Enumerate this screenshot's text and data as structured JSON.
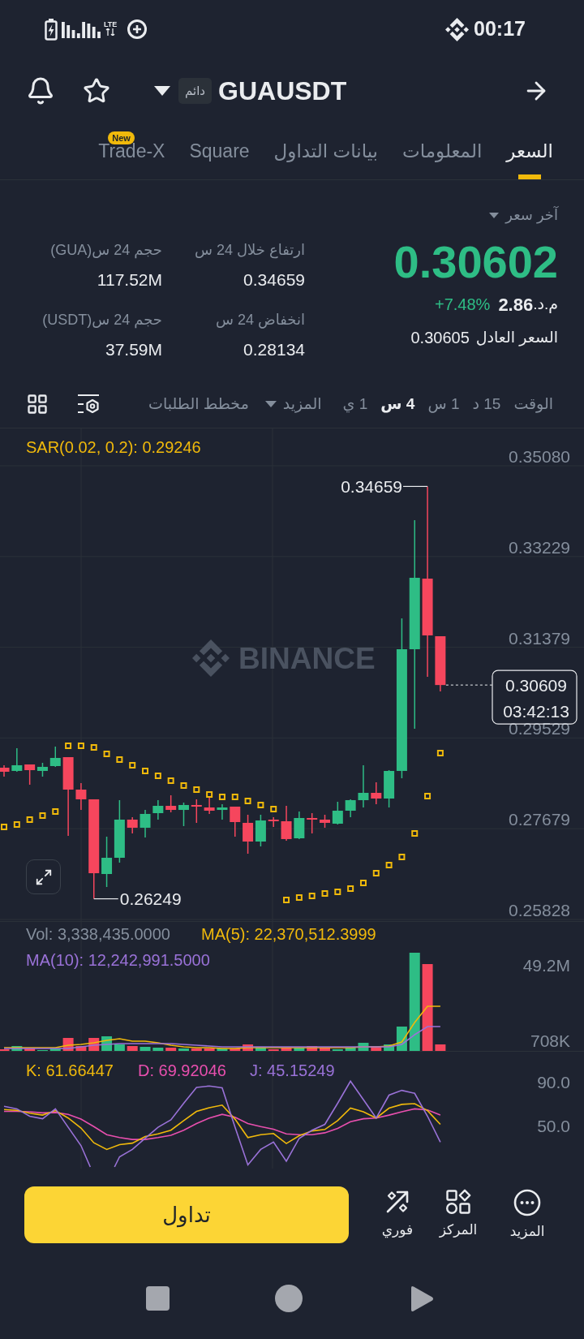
{
  "status_bar": {
    "network_type": "LTE",
    "time": "00:17"
  },
  "header": {
    "badge": "دائم",
    "symbol": "GUAUSDT"
  },
  "tabs": [
    {
      "label": "السعر",
      "selected": true
    },
    {
      "label": "المعلومات",
      "selected": false
    },
    {
      "label": "بيانات التداول",
      "selected": false
    },
    {
      "label": "Square",
      "selected": false
    },
    {
      "label": "Trade-X",
      "selected": false,
      "badge": "New"
    }
  ],
  "price_panel": {
    "price_type": "آخر سعر",
    "last_price": "0.30602",
    "change_percent": "+7.48%",
    "change_amount": "2.86",
    "currency": "م.د.",
    "fair_price_label": "السعر العادل",
    "fair_price": "0.30605"
  },
  "stats": [
    {
      "label": "ارتفاع خلال 24 س",
      "value": "0.34659"
    },
    {
      "label": "حجم 24 س(GUA)",
      "value": "117.52M"
    },
    {
      "label": "انخفاض 24 س",
      "value": "0.28134"
    },
    {
      "label": "حجم 24 س(USDT)",
      "value": "37.59M"
    }
  ],
  "chart_toolbar": {
    "label": "الوقت",
    "intervals": [
      {
        "label": "15 د",
        "selected": false
      },
      {
        "label": "1 س",
        "selected": false
      },
      {
        "label": "4 س",
        "selected": true
      },
      {
        "label": "1 ي",
        "selected": false
      }
    ],
    "more": "المزيد",
    "depth": "مخطط الطلبات"
  },
  "price_chart": {
    "indicator": "SAR(0.02, 0.2): 0.29246",
    "watermark": "BINANCE",
    "high_label": "0.34659",
    "low_label": "0.26249",
    "current_price": "0.30609",
    "countdown": "03:42:13",
    "chart_data": {
      "type": "candlestick",
      "grid": true,
      "ohlc": [
        [
          0.28923,
          0.28973,
          0.28741,
          0.2884
        ],
        [
          0.28857,
          0.2932,
          0.2884,
          0.28973
        ],
        [
          0.28989,
          0.28989,
          0.28576,
          0.28873
        ],
        [
          0.28857,
          0.29022,
          0.28741,
          0.2894
        ],
        [
          0.28956,
          0.29353,
          0.2894,
          0.29122
        ],
        [
          0.29138,
          0.29138,
          0.27533,
          0.28476
        ],
        [
          0.28476,
          0.28609,
          0.28062,
          0.28278
        ],
        [
          0.28278,
          0.28278,
          0.26249,
          0.26771
        ],
        [
          0.26755,
          0.27516,
          0.2649,
          0.27086
        ],
        [
          0.27086,
          0.28261,
          0.26987,
          0.27864
        ],
        [
          0.27864,
          0.27913,
          0.27582,
          0.27698
        ],
        [
          0.27698,
          0.28062,
          0.275,
          0.2798
        ],
        [
          0.27996,
          0.28261,
          0.27864,
          0.28145
        ],
        [
          0.28145,
          0.2836,
          0.28013,
          0.28062
        ],
        [
          0.28062,
          0.28211,
          0.27731,
          0.28162
        ],
        [
          0.28162,
          0.28278,
          0.27798,
          0.28129
        ],
        [
          0.28112,
          0.28327,
          0.2798,
          0.28046
        ],
        [
          0.28062,
          0.28178,
          0.27864,
          0.28112
        ],
        [
          0.28129,
          0.28129,
          0.27516,
          0.27814
        ],
        [
          0.27798,
          0.27963,
          0.27169,
          0.27417
        ],
        [
          0.27417,
          0.27963,
          0.27318,
          0.27847
        ],
        [
          0.27864,
          0.27913,
          0.27715,
          0.27831
        ],
        [
          0.27831,
          0.28145,
          0.27433,
          0.27467
        ],
        [
          0.27483,
          0.28029,
          0.27467,
          0.27897
        ],
        [
          0.27897,
          0.27996,
          0.27582,
          0.27864
        ],
        [
          0.27864,
          0.27963,
          0.27698,
          0.27798
        ],
        [
          0.27781,
          0.28228,
          0.27765,
          0.28046
        ],
        [
          0.28046,
          0.28278,
          0.27913,
          0.28261
        ],
        [
          0.28261,
          0.28973,
          0.28112,
          0.2841
        ],
        [
          0.2841,
          0.28625,
          0.28178,
          0.28294
        ],
        [
          0.28294,
          0.28873,
          0.28112,
          0.28857
        ],
        [
          0.28857,
          0.31968,
          0.28708,
          0.31339
        ],
        [
          0.31339,
          0.33971,
          0.29717,
          0.32796
        ],
        [
          0.32779,
          0.34659,
          0.30777,
          0.31621
        ],
        [
          0.31604,
          0.31604,
          0.30479,
          0.30609
        ]
      ],
      "ylim": [
        0.25795,
        0.35841
      ],
      "yticks": [
        {
          "value": 0.3508,
          "label": "0.35080"
        },
        {
          "value": 0.33229,
          "label": "0.33229"
        },
        {
          "value": 0.31379,
          "label": "0.31379"
        },
        {
          "value": 0.29529,
          "label": "0.29529"
        },
        {
          "value": 0.27679,
          "label": "0.27679"
        },
        {
          "value": 0.25828,
          "label": "0.25828"
        }
      ]
    }
  },
  "volume_chart": {
    "vol": "Vol: 3,338,435.0000",
    "ma5": "MA(5): 22,370,512.3999",
    "ma10": "MA(10): 12,242,991.5000",
    "axis": [
      "49.2M",
      "708K"
    ]
  },
  "kdj_chart": {
    "k": "K: 61.66447",
    "d": "D: 69.92046",
    "j": "J: 45.15249",
    "axis": [
      "90.0",
      "50.0"
    ]
  },
  "actions": {
    "trade_button": "تداول",
    "items": [
      {
        "label": "المزيد",
        "kind": "more"
      },
      {
        "label": "المركز",
        "kind": "hub"
      },
      {
        "label": "فوري",
        "kind": "spot"
      }
    ]
  }
}
